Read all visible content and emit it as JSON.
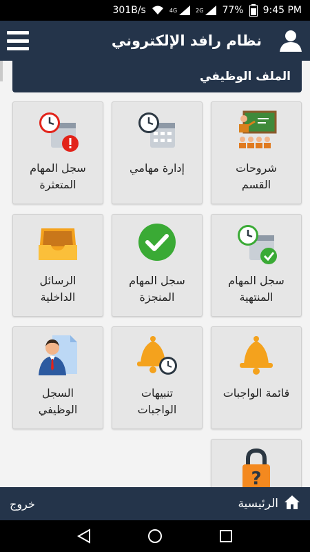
{
  "status_bar": {
    "speed": "301B/s",
    "network": "4G",
    "network2": "2G",
    "battery": "77%",
    "time": "9:45 PM"
  },
  "app_bar": {
    "title": "نظام رافد الإلكتروني"
  },
  "section": {
    "title": "الملف الوظيفي"
  },
  "tiles": [
    {
      "label": "شروحات\nالقسم",
      "icon": "classroom-icon"
    },
    {
      "label": "إدارة مهامي",
      "icon": "clock-calendar-icon"
    },
    {
      "label": "سجل المهام\nالمتعثرة",
      "icon": "clock-calendar-alert-icon"
    },
    {
      "label": "سجل المهام\nالمنتهية",
      "icon": "clock-calendar-check-icon"
    },
    {
      "label": "سجل المهام\nالمنجزة",
      "icon": "check-circle-icon"
    },
    {
      "label": "الرسائل\nالداخلية",
      "icon": "inbox-tray-icon"
    },
    {
      "label": "قائمة الواجبات",
      "icon": "bell-icon"
    },
    {
      "label": "تنبيهات\nالواجبات",
      "icon": "bell-clock-icon"
    },
    {
      "label": "السجل\nالوظيفي",
      "icon": "employee-document-icon"
    },
    {
      "label": "",
      "icon": "lock-question-icon"
    }
  ],
  "bottom_bar": {
    "home_label": "الرئيسية",
    "logout_label": "خروج"
  },
  "colors": {
    "header_bg": "#24344a",
    "tile_bg": "#e6e6e6",
    "page_bg": "#f3f3f3",
    "accent_orange": "#f4a21d",
    "check_green": "#3aaa35",
    "alert_red": "#e2231a"
  }
}
